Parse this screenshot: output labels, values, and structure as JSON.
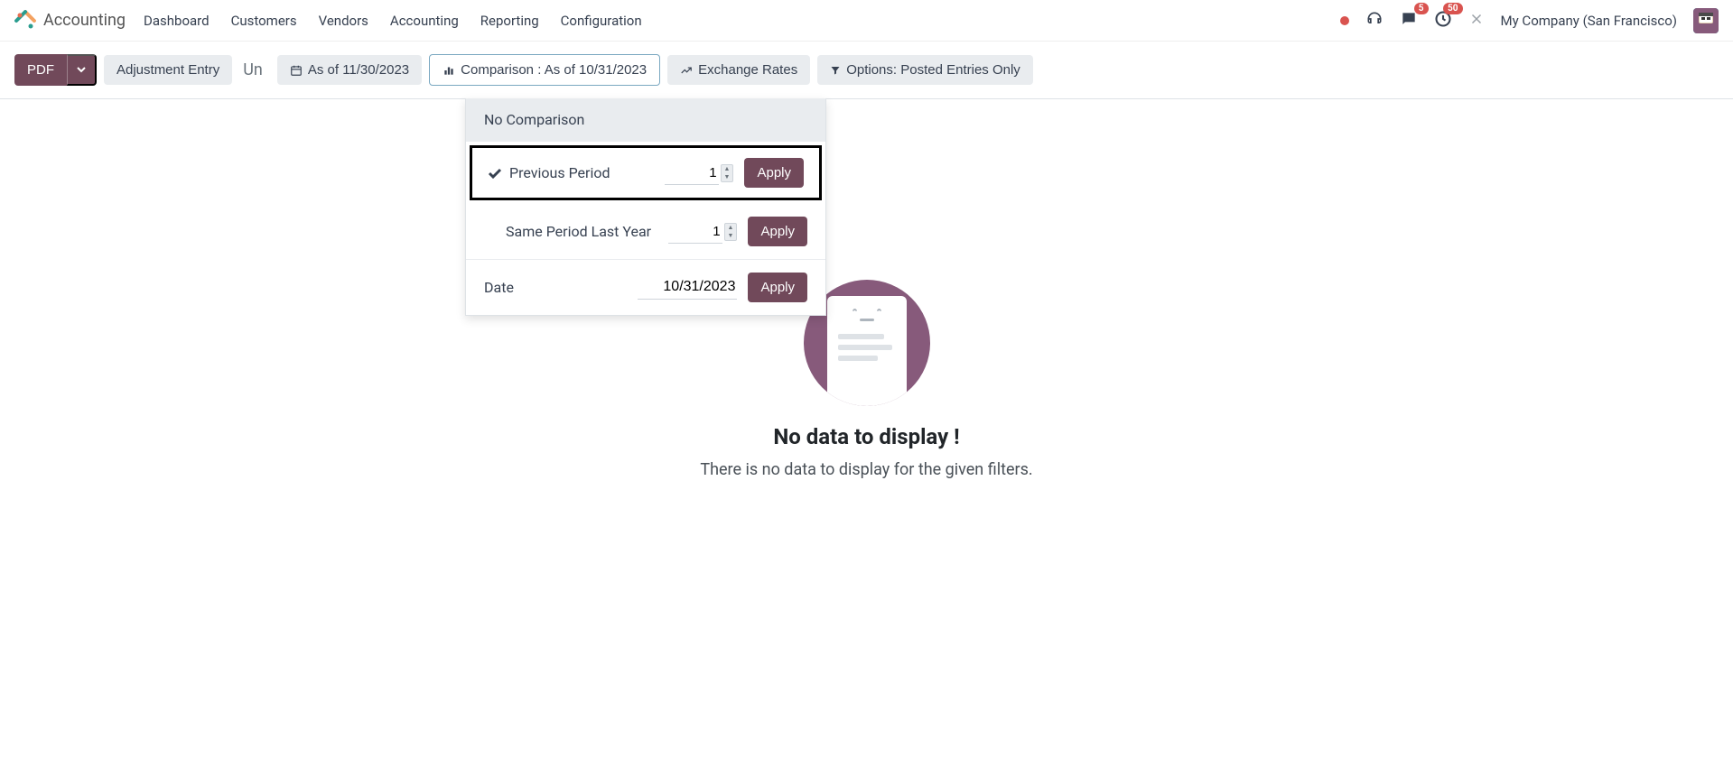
{
  "brand": {
    "title": "Accounting"
  },
  "nav": {
    "items": [
      "Dashboard",
      "Customers",
      "Vendors",
      "Accounting",
      "Reporting",
      "Configuration"
    ]
  },
  "topbar": {
    "messages_badge": "5",
    "activities_badge": "50",
    "company": "My Company (San Francisco)"
  },
  "toolbar": {
    "pdf": "PDF",
    "adjustment": "Adjustment Entry",
    "breadcrumb_partial": "Un",
    "asof": "As of 11/30/2023",
    "comparison": "Comparison : As of 10/31/2023",
    "exchange": "Exchange Rates",
    "options": "Options: Posted Entries Only"
  },
  "comparison_panel": {
    "no_comparison": "No Comparison",
    "previous_period": {
      "label": "Previous Period",
      "value": "1",
      "apply": "Apply"
    },
    "same_period": {
      "label": "Same Period Last Year",
      "value": "1",
      "apply": "Apply"
    },
    "date": {
      "label": "Date",
      "value": "10/31/2023",
      "apply": "Apply"
    }
  },
  "empty": {
    "title": "No data to display !",
    "sub": "There is no data to display for the given filters."
  }
}
